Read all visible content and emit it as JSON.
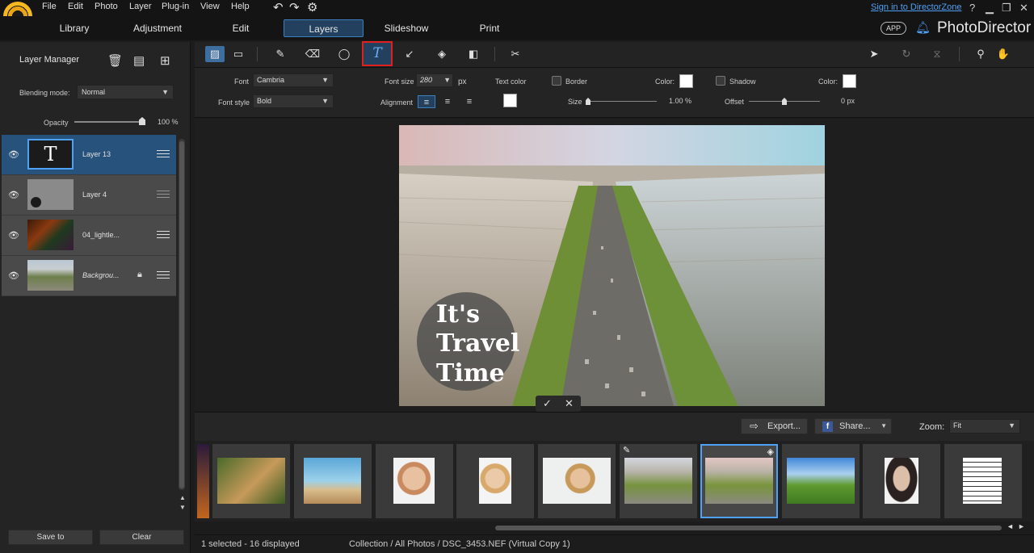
{
  "menu": [
    "File",
    "Edit",
    "Photo",
    "Layer",
    "Plug-in",
    "View",
    "Help"
  ],
  "header": {
    "signin": "Sign in to DirectorZone",
    "help": "?",
    "app_badge": "APP",
    "brand": "PhotoDirector"
  },
  "tabs": [
    {
      "label": "Library",
      "active": false
    },
    {
      "label": "Adjustment",
      "active": false
    },
    {
      "label": "Edit",
      "active": false
    },
    {
      "label": "Layers",
      "active": true
    },
    {
      "label": "Slideshow",
      "active": false
    },
    {
      "label": "Print",
      "active": false
    }
  ],
  "layer_manager": {
    "title": "Layer Manager",
    "blending_label": "Blending mode:",
    "blending_value": "Normal",
    "opacity_label": "Opacity",
    "opacity_value": "100 %",
    "layers": [
      {
        "name": "Layer 13",
        "thumb": "T",
        "selected": true
      },
      {
        "name": "Layer 4",
        "selected": false
      },
      {
        "name": "04_lightle...",
        "selected": false
      },
      {
        "name": "Backgrou...",
        "selected": false,
        "locked": true
      }
    ],
    "save_label": "Save to",
    "clear_label": "Clear"
  },
  "text_options": {
    "font_label": "Font",
    "font_value": "Cambria",
    "font_style_label": "Font style",
    "font_style_value": "Bold",
    "font_size_label": "Font size",
    "font_size_value": "280",
    "font_size_unit": "px",
    "alignment_label": "Alignment",
    "text_color_label": "Text color",
    "border_label": "Border",
    "border_color_label": "Color:",
    "size_label": "Size",
    "size_value": "1.00 %",
    "shadow_label": "Shadow",
    "shadow_color_label": "Color:",
    "offset_label": "Offset",
    "offset_value": "0 px",
    "text_color": "#ffffff"
  },
  "canvas": {
    "text_lines": [
      "It's",
      "Travel",
      "Time"
    ]
  },
  "bottom_toolbar": {
    "export_label": "Export...",
    "share_label": "Share...",
    "zoom_label": "Zoom:",
    "zoom_value": "Fit"
  },
  "status": {
    "selection": "1 selected - 16 displayed",
    "path": "Collection / All Photos / DSC_3453.NEF (Virtual Copy 1)"
  },
  "colors": {
    "accent": "#4ea1f5",
    "tab_active_bg": "#23415e",
    "highlight_red": "#e21f1f",
    "selected_layer": "#26527c"
  }
}
